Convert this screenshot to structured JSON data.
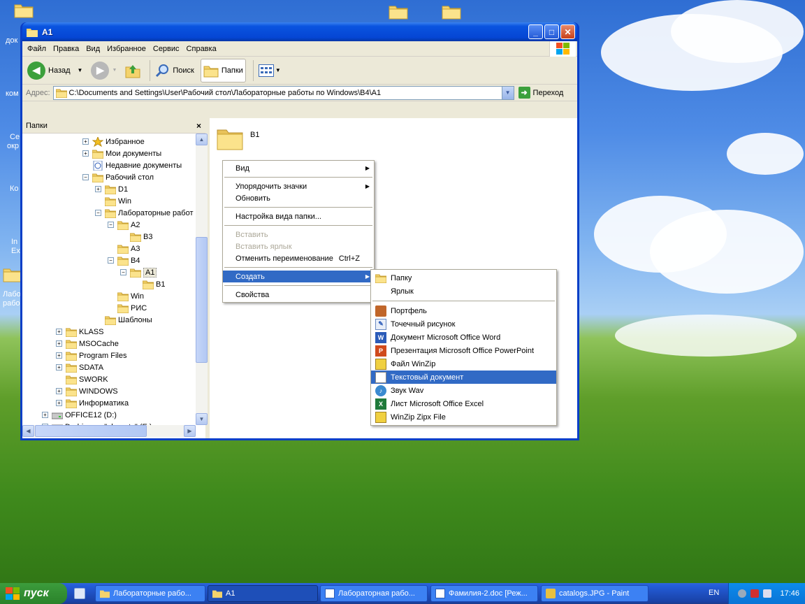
{
  "window": {
    "title": "A1",
    "menu": [
      "Файл",
      "Правка",
      "Вид",
      "Избранное",
      "Сервис",
      "Справка"
    ],
    "toolbar": {
      "back": "Назад",
      "search": "Поиск",
      "folders": "Папки"
    },
    "address": {
      "label": "Адрес:",
      "value": "C:\\Documents and Settings\\User\\Рабочий стол\\Лабораторные работы по Windows\\B4\\A1",
      "go": "Переход"
    }
  },
  "folders_pane": {
    "title": "Папки",
    "tree": [
      {
        "label": "Избранное",
        "exp": "+"
      },
      {
        "label": "Мои документы",
        "exp": "+"
      },
      {
        "label": "Недавние документы",
        "exp": ""
      },
      {
        "label": "Рабочий стол",
        "exp": "−"
      },
      {
        "label": "D1",
        "exp": "+"
      },
      {
        "label": "Win",
        "exp": ""
      },
      {
        "label": "Лабораторные работ",
        "exp": "−"
      },
      {
        "label": "A2",
        "exp": "−"
      },
      {
        "label": "B3",
        "exp": ""
      },
      {
        "label": "A3",
        "exp": ""
      },
      {
        "label": "B4",
        "exp": "−"
      },
      {
        "label": "A1",
        "exp": "−"
      },
      {
        "label": "B1",
        "exp": ""
      },
      {
        "label": "Win",
        "exp": ""
      },
      {
        "label": "РИС",
        "exp": ""
      },
      {
        "label": "Шаблоны",
        "exp": ""
      },
      {
        "label": "KLASS",
        "exp": "+"
      },
      {
        "label": "MSOCache",
        "exp": "+"
      },
      {
        "label": "Program Files",
        "exp": "+"
      },
      {
        "label": "SDATA",
        "exp": "+"
      },
      {
        "label": "SWORK",
        "exp": ""
      },
      {
        "label": "WINDOWS",
        "exp": "+"
      },
      {
        "label": "Информатика",
        "exp": "+"
      },
      {
        "label": "OFFICE12 (D:)",
        "exp": "+"
      },
      {
        "label": "D_drive на \"ubmarty\" (E:)",
        "exp": "+"
      }
    ]
  },
  "content": {
    "folder": "B1"
  },
  "context_menu": {
    "items": [
      {
        "label": "Вид",
        "sub": true
      },
      {
        "label": "Упорядочить значки",
        "sub": true
      },
      {
        "label": "Обновить"
      },
      {
        "label": "Настройка вида папки..."
      },
      {
        "label": "Вставить",
        "disabled": true
      },
      {
        "label": "Вставить ярлык",
        "disabled": true
      },
      {
        "label": "Отменить переименование",
        "shortcut": "Ctrl+Z"
      },
      {
        "label": "Создать",
        "sub": true
      },
      {
        "label": "Свойства"
      }
    ]
  },
  "submenu": {
    "items": [
      "Папку",
      "Ярлык",
      "Портфель",
      "Точечный рисунок",
      "Документ Microsoft Office Word",
      "Презентация Microsoft Office PowerPoint",
      "Файл WinZip",
      "Текстовый документ",
      "Звук Wav",
      "Лист Microsoft Office Excel",
      "WinZip Zipx File"
    ]
  },
  "taskbar": {
    "start": "пуск",
    "items": [
      "Лабораторные рабо...",
      "A1",
      "Лабораторная рабо...",
      "Фамилия-2.doc [Реж...",
      "catalogs.JPG - Paint"
    ],
    "lang": "EN",
    "clock": "17:46"
  },
  "desktop": {
    "left_labels": [
      "док",
      "ком",
      "Се",
      "окр",
      "Ко",
      "In",
      "Ex",
      "Лабо",
      "рабо"
    ]
  }
}
